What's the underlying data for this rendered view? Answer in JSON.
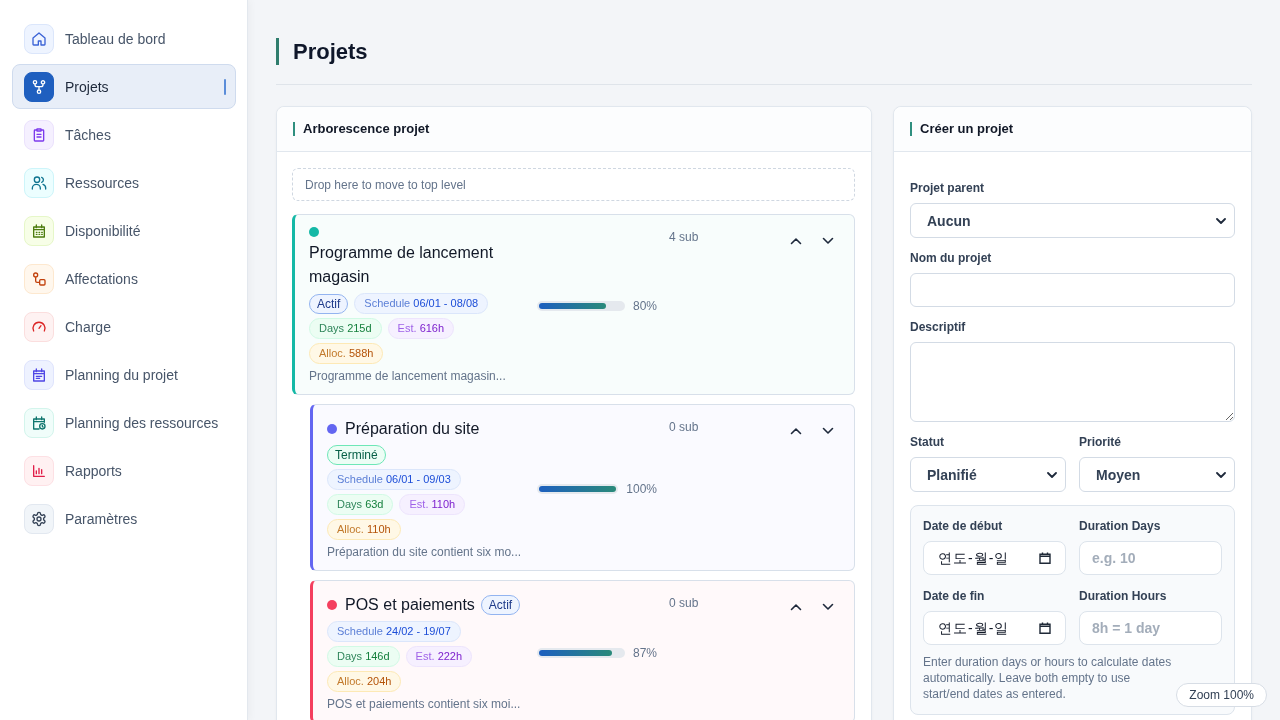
{
  "sidebar": {
    "items": [
      {
        "label": "Tableau de bord",
        "selected": false
      },
      {
        "label": "Projets",
        "selected": true
      },
      {
        "label": "Tâches",
        "selected": false
      },
      {
        "label": "Ressources",
        "selected": false
      },
      {
        "label": "Disponibilité",
        "selected": false
      },
      {
        "label": "Affectations",
        "selected": false
      },
      {
        "label": "Charge",
        "selected": false
      },
      {
        "label": "Planning du projet",
        "selected": false
      },
      {
        "label": "Planning des ressources",
        "selected": false
      },
      {
        "label": "Rapports",
        "selected": false
      },
      {
        "label": "Paramètres",
        "selected": false
      }
    ]
  },
  "page": {
    "title": "Projets"
  },
  "tree_panel": {
    "title": "Arborescence projet",
    "drop_zone": "Drop here to move to top level",
    "projects": [
      {
        "title": "Programme de lancement magasin",
        "color": "#14b8a6",
        "status": {
          "kind": "active",
          "label": "Actif"
        },
        "chips": [
          {
            "kind": "schedule",
            "label": "Schedule",
            "value": "06/01 - 08/08"
          },
          {
            "kind": "days",
            "label": "Days",
            "value": "215d"
          },
          {
            "kind": "estimate",
            "label": "Est.",
            "value": "616h"
          },
          {
            "kind": "allocated",
            "label": "Alloc.",
            "value": "588h"
          }
        ],
        "level": 0.8,
        "reading": "80%",
        "sub_count": "4 sub",
        "description": "Programme de lancement magasin...",
        "children": [
          {
            "title": "Préparation du site",
            "color": "#6366f1",
            "status": {
              "kind": "done",
              "label": "Terminé"
            },
            "chips": [
              {
                "kind": "schedule",
                "label": "Schedule",
                "value": "06/01 - 09/03"
              },
              {
                "kind": "days",
                "label": "Days",
                "value": "63d"
              },
              {
                "kind": "estimate",
                "label": "Est.",
                "value": "110h"
              },
              {
                "kind": "allocated",
                "label": "Alloc.",
                "value": "110h"
              }
            ],
            "level": 1,
            "reading": "100%",
            "sub_count": "0 sub",
            "description": "Préparation du site contient six mo..."
          },
          {
            "title": "POS et paiements",
            "color": "#f43f5e",
            "status": {
              "kind": "active",
              "label": "Actif"
            },
            "chips": [
              {
                "kind": "schedule",
                "label": "Schedule",
                "value": "24/02 - 19/07"
              },
              {
                "kind": "days",
                "label": "Days",
                "value": "146d"
              },
              {
                "kind": "estimate",
                "label": "Est.",
                "value": "222h"
              },
              {
                "kind": "allocated",
                "label": "Alloc.",
                "value": "204h"
              }
            ],
            "level": 0.87,
            "reading": "87%",
            "sub_count": "0 sub",
            "description": "POS et paiements contient six moi..."
          }
        ]
      }
    ]
  },
  "create_panel": {
    "title": "Créer un projet",
    "parent": {
      "label": "Projet parent",
      "value": "Aucun"
    },
    "name": {
      "label": "Nom du projet"
    },
    "description": {
      "label": "Descriptif"
    },
    "status": {
      "label": "Statut",
      "value": "Planifié"
    },
    "priority": {
      "label": "Priorité",
      "value": "Moyen"
    },
    "schedule": {
      "start_date": {
        "label": "Date de début",
        "placeholder": "연도-월-일"
      },
      "duration_days": {
        "label": "Duration Days",
        "placeholder": "e.g. 10"
      },
      "end_date": {
        "label": "Date de fin",
        "placeholder": "연도-월-일"
      },
      "duration_hours": {
        "label": "Duration Hours",
        "placeholder": "8h = 1 day"
      },
      "help": "Enter duration days or hours to calculate dates automatically. Leave both empty to use start/end dates as entered."
    }
  },
  "zoom_indicator": "Zoom 100%"
}
